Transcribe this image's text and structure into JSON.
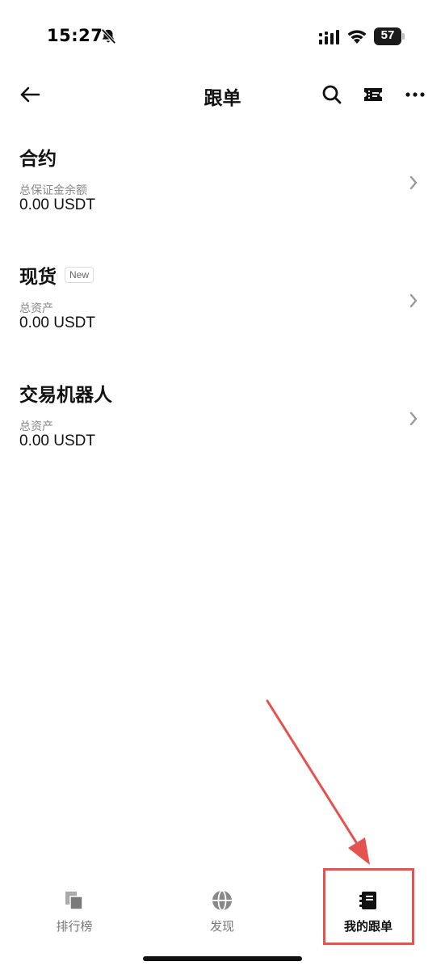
{
  "status_bar": {
    "time": "15:27",
    "battery": "57"
  },
  "nav": {
    "title": "跟单"
  },
  "sections": [
    {
      "title": "合约",
      "badge": "",
      "label": "总保证金余额",
      "value": "0.00 USDT"
    },
    {
      "title": "现货",
      "badge": "New",
      "label": "总资产",
      "value": "0.00 USDT"
    },
    {
      "title": "交易机器人",
      "badge": "",
      "label": "总资产",
      "value": "0.00 USDT"
    }
  ],
  "tabs": [
    {
      "label": "排行榜",
      "icon": "copy-icon",
      "active": false
    },
    {
      "label": "发现",
      "icon": "globe-icon",
      "active": false
    },
    {
      "label": "我的跟单",
      "icon": "notebook-icon",
      "active": true
    }
  ],
  "colors": {
    "annotation": "#e5524f",
    "text": "#111111",
    "muted": "#888888"
  }
}
